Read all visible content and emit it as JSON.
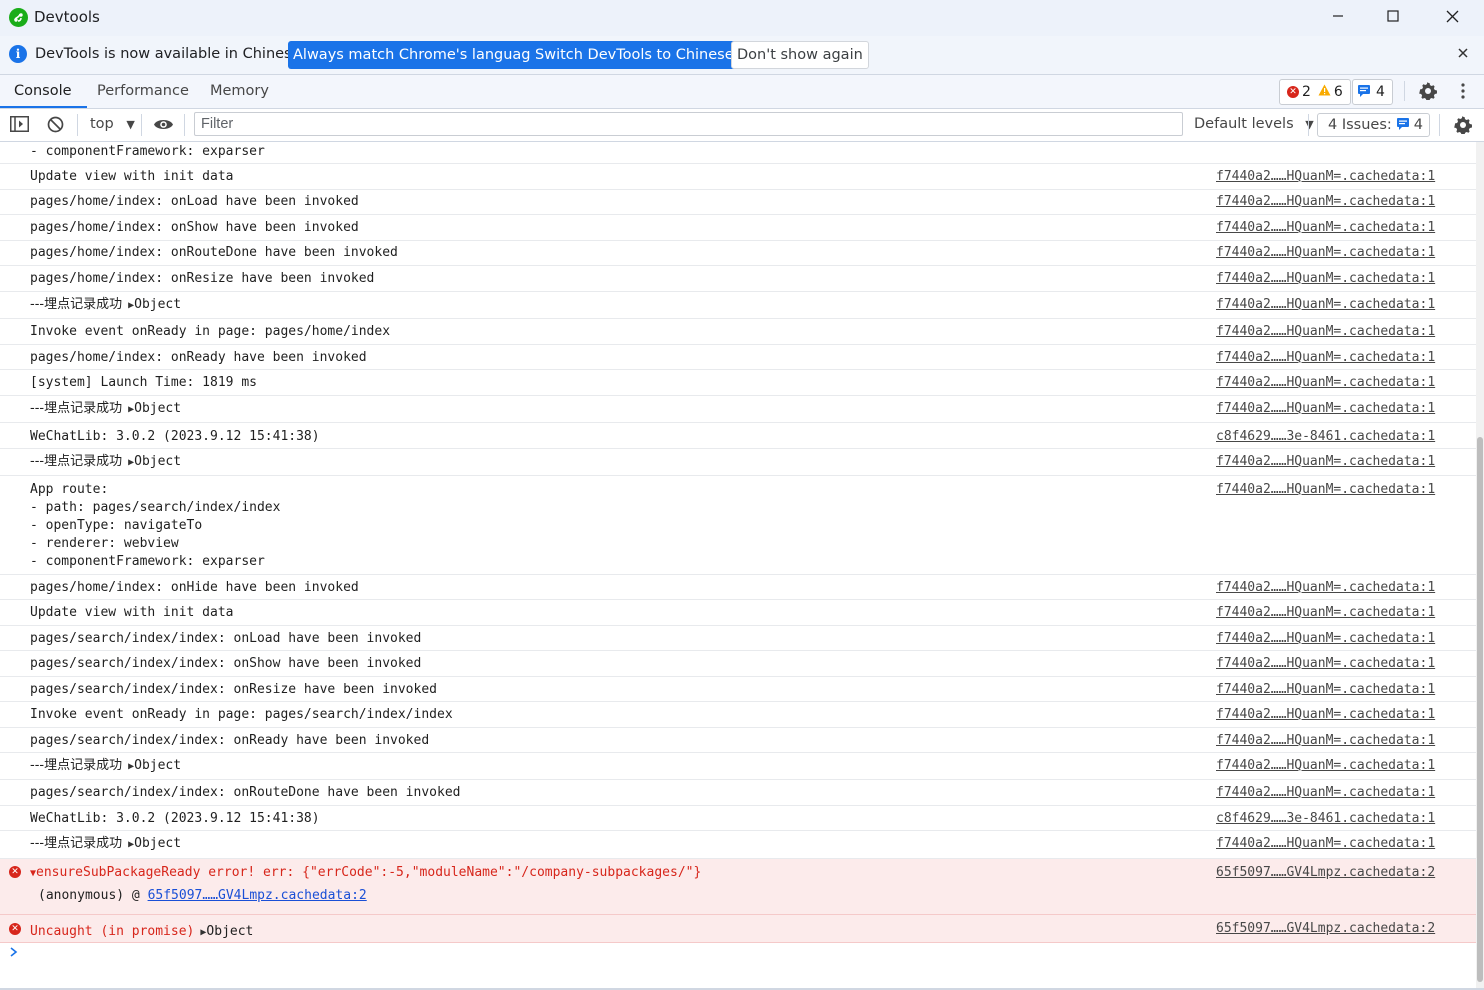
{
  "window": {
    "title": "Devtools",
    "minimize_icon": "minimize-icon",
    "maximize_icon": "maximize-icon",
    "close_icon": "close-icon"
  },
  "infobar": {
    "message": "DevTools is now available in Chinese!",
    "btn_match": "Always match Chrome's language",
    "btn_switch": "Switch DevTools to Chinese",
    "btn_dont_show": "Don't show again"
  },
  "tabs": [
    "Console",
    "Performance",
    "Memory"
  ],
  "counters": {
    "errors": "2",
    "warnings": "6",
    "messages": "4"
  },
  "toolbar": {
    "context": "top",
    "filter_placeholder": "Filter",
    "levels": "Default levels",
    "issues_label": "4 Issues:",
    "issues_count": "4"
  },
  "logs": [
    {
      "msg": "- componentFramework: exparser",
      "src": ""
    },
    {
      "msg": "Update view with init data",
      "src": "f7440a2……HQuanM=.cachedata:1"
    },
    {
      "msg": "pages/home/index: onLoad have been invoked",
      "src": "f7440a2……HQuanM=.cachedata:1"
    },
    {
      "msg": "pages/home/index: onShow have been invoked",
      "src": "f7440a2……HQuanM=.cachedata:1"
    },
    {
      "msg": "pages/home/index: onRouteDone have been invoked",
      "src": "f7440a2……HQuanM=.cachedata:1"
    },
    {
      "msg": "pages/home/index: onResize have been invoked",
      "src": "f7440a2……HQuanM=.cachedata:1"
    },
    {
      "msg": "---埋点记录成功",
      "obj": "Object",
      "src": "f7440a2……HQuanM=.cachedata:1"
    },
    {
      "msg": "Invoke event onReady in page: pages/home/index",
      "src": "f7440a2……HQuanM=.cachedata:1"
    },
    {
      "msg": "pages/home/index: onReady have been invoked",
      "src": "f7440a2……HQuanM=.cachedata:1"
    },
    {
      "msg": "[system] Launch Time: 1819 ms",
      "src": "f7440a2……HQuanM=.cachedata:1"
    },
    {
      "msg": "---埋点记录成功",
      "obj": "Object",
      "src": "f7440a2……HQuanM=.cachedata:1"
    },
    {
      "msg": "WeChatLib: 3.0.2 (2023.9.12 15:41:38)",
      "src": "c8f4629……3e-8461.cachedata:1"
    },
    {
      "msg": "---埋点记录成功",
      "obj": "Object",
      "src": "f7440a2……HQuanM=.cachedata:1"
    },
    {
      "msg": "App route:\n- path: pages/search/index/index\n- openType: navigateTo\n- renderer: webview\n- componentFramework: exparser",
      "src": "f7440a2……HQuanM=.cachedata:1"
    },
    {
      "msg": "pages/home/index: onHide have been invoked",
      "src": "f7440a2……HQuanM=.cachedata:1"
    },
    {
      "msg": "Update view with init data",
      "src": "f7440a2……HQuanM=.cachedata:1"
    },
    {
      "msg": "pages/search/index/index: onLoad have been invoked",
      "src": "f7440a2……HQuanM=.cachedata:1"
    },
    {
      "msg": "pages/search/index/index: onShow have been invoked",
      "src": "f7440a2……HQuanM=.cachedata:1"
    },
    {
      "msg": "pages/search/index/index: onResize have been invoked",
      "src": "f7440a2……HQuanM=.cachedata:1"
    },
    {
      "msg": "Invoke event onReady in page: pages/search/index/index",
      "src": "f7440a2……HQuanM=.cachedata:1"
    },
    {
      "msg": "pages/search/index/index: onReady have been invoked",
      "src": "f7440a2……HQuanM=.cachedata:1"
    },
    {
      "msg": "---埋点记录成功",
      "obj": "Object",
      "src": "f7440a2……HQuanM=.cachedata:1"
    },
    {
      "msg": "pages/search/index/index: onRouteDone have been invoked",
      "src": "f7440a2……HQuanM=.cachedata:1"
    },
    {
      "msg": "WeChatLib: 3.0.2 (2023.9.12 15:41:38)",
      "src": "c8f4629……3e-8461.cachedata:1"
    },
    {
      "msg": "---埋点记录成功",
      "obj": "Object",
      "src": "f7440a2……HQuanM=.cachedata:1"
    }
  ],
  "errors": [
    {
      "msg": "ensureSubPackageReady error! err: {\"errCode\":-5,\"moduleName\":\"/company-subpackages/\"}",
      "stack_prefix": "(anonymous) @ ",
      "stack_link": "65f5097……GV4Lmpz.cachedata:2",
      "src": "65f5097……GV4Lmpz.cachedata:2"
    },
    {
      "msg": "Uncaught (in promise)",
      "obj": "Object",
      "src": "65f5097……GV4Lmpz.cachedata:2"
    }
  ],
  "colors": {
    "accent": "#1a73e8",
    "error": "#d7261b",
    "error_bg": "#fcebeb",
    "warning": "#f9ab00"
  }
}
